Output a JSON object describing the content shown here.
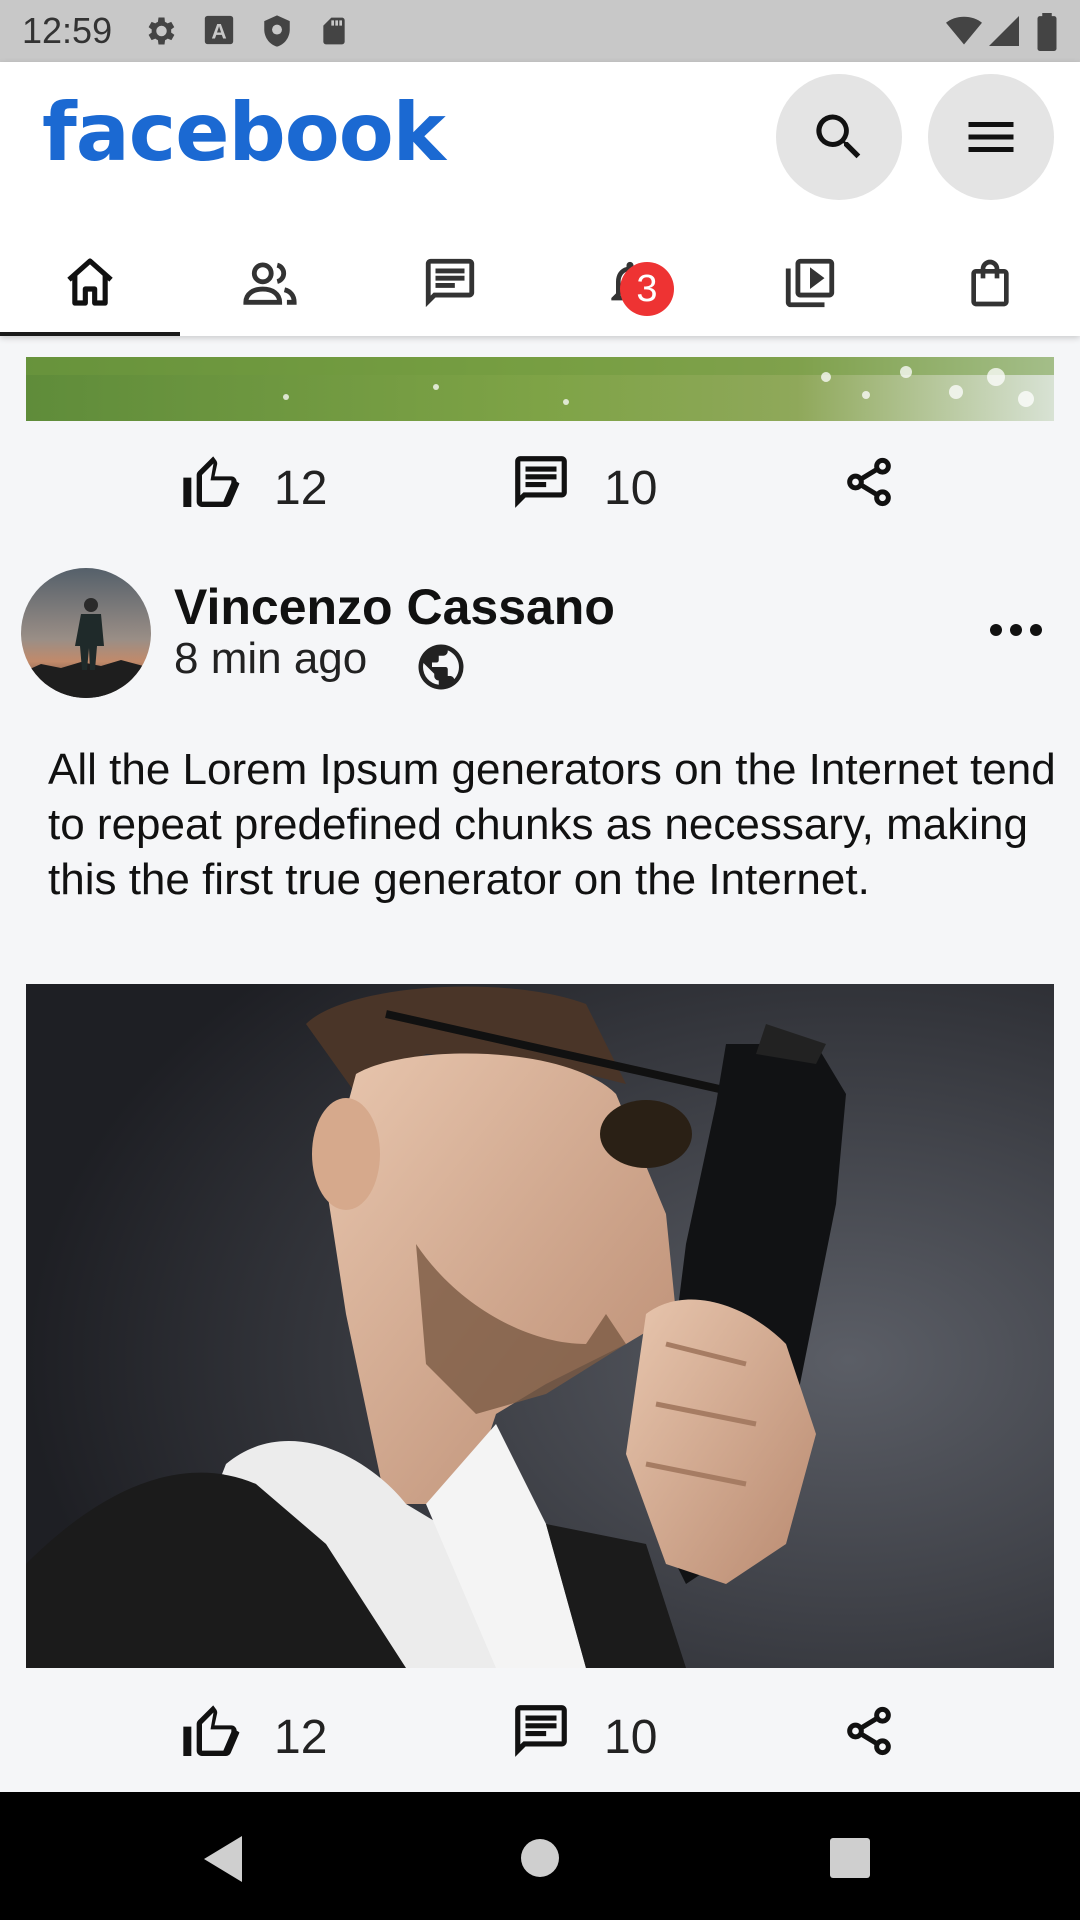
{
  "status_bar": {
    "time": "12:59",
    "icons": [
      "settings-icon",
      "font-icon",
      "shield-icon",
      "sd-card-icon",
      "wifi-icon",
      "signal-icon",
      "battery-icon"
    ]
  },
  "header": {
    "logo": "facebook",
    "logo_color": "#1b69d2",
    "actions": [
      "search-icon",
      "menu-icon"
    ]
  },
  "tabs": [
    {
      "name": "home",
      "icon": "home-icon",
      "active": true
    },
    {
      "name": "friends",
      "icon": "people-icon"
    },
    {
      "name": "messages",
      "icon": "message-icon"
    },
    {
      "name": "notifications",
      "icon": "bell-icon",
      "badge": "3"
    },
    {
      "name": "watch",
      "icon": "video-icon"
    },
    {
      "name": "marketplace",
      "icon": "shopping-bag-icon"
    }
  ],
  "posts": [
    {
      "likes": "12",
      "comments": "10"
    },
    {
      "author": "Vincenzo Cassano",
      "time": "8 min ago",
      "text": "All the Lorem Ipsum generators on the Internet tend to repeat predefined chunks as necessary, making this the first true generator on the Internet.",
      "likes": "12",
      "comments": "10"
    }
  ],
  "nav": [
    "back-icon",
    "home-circle-icon",
    "recents-icon"
  ]
}
